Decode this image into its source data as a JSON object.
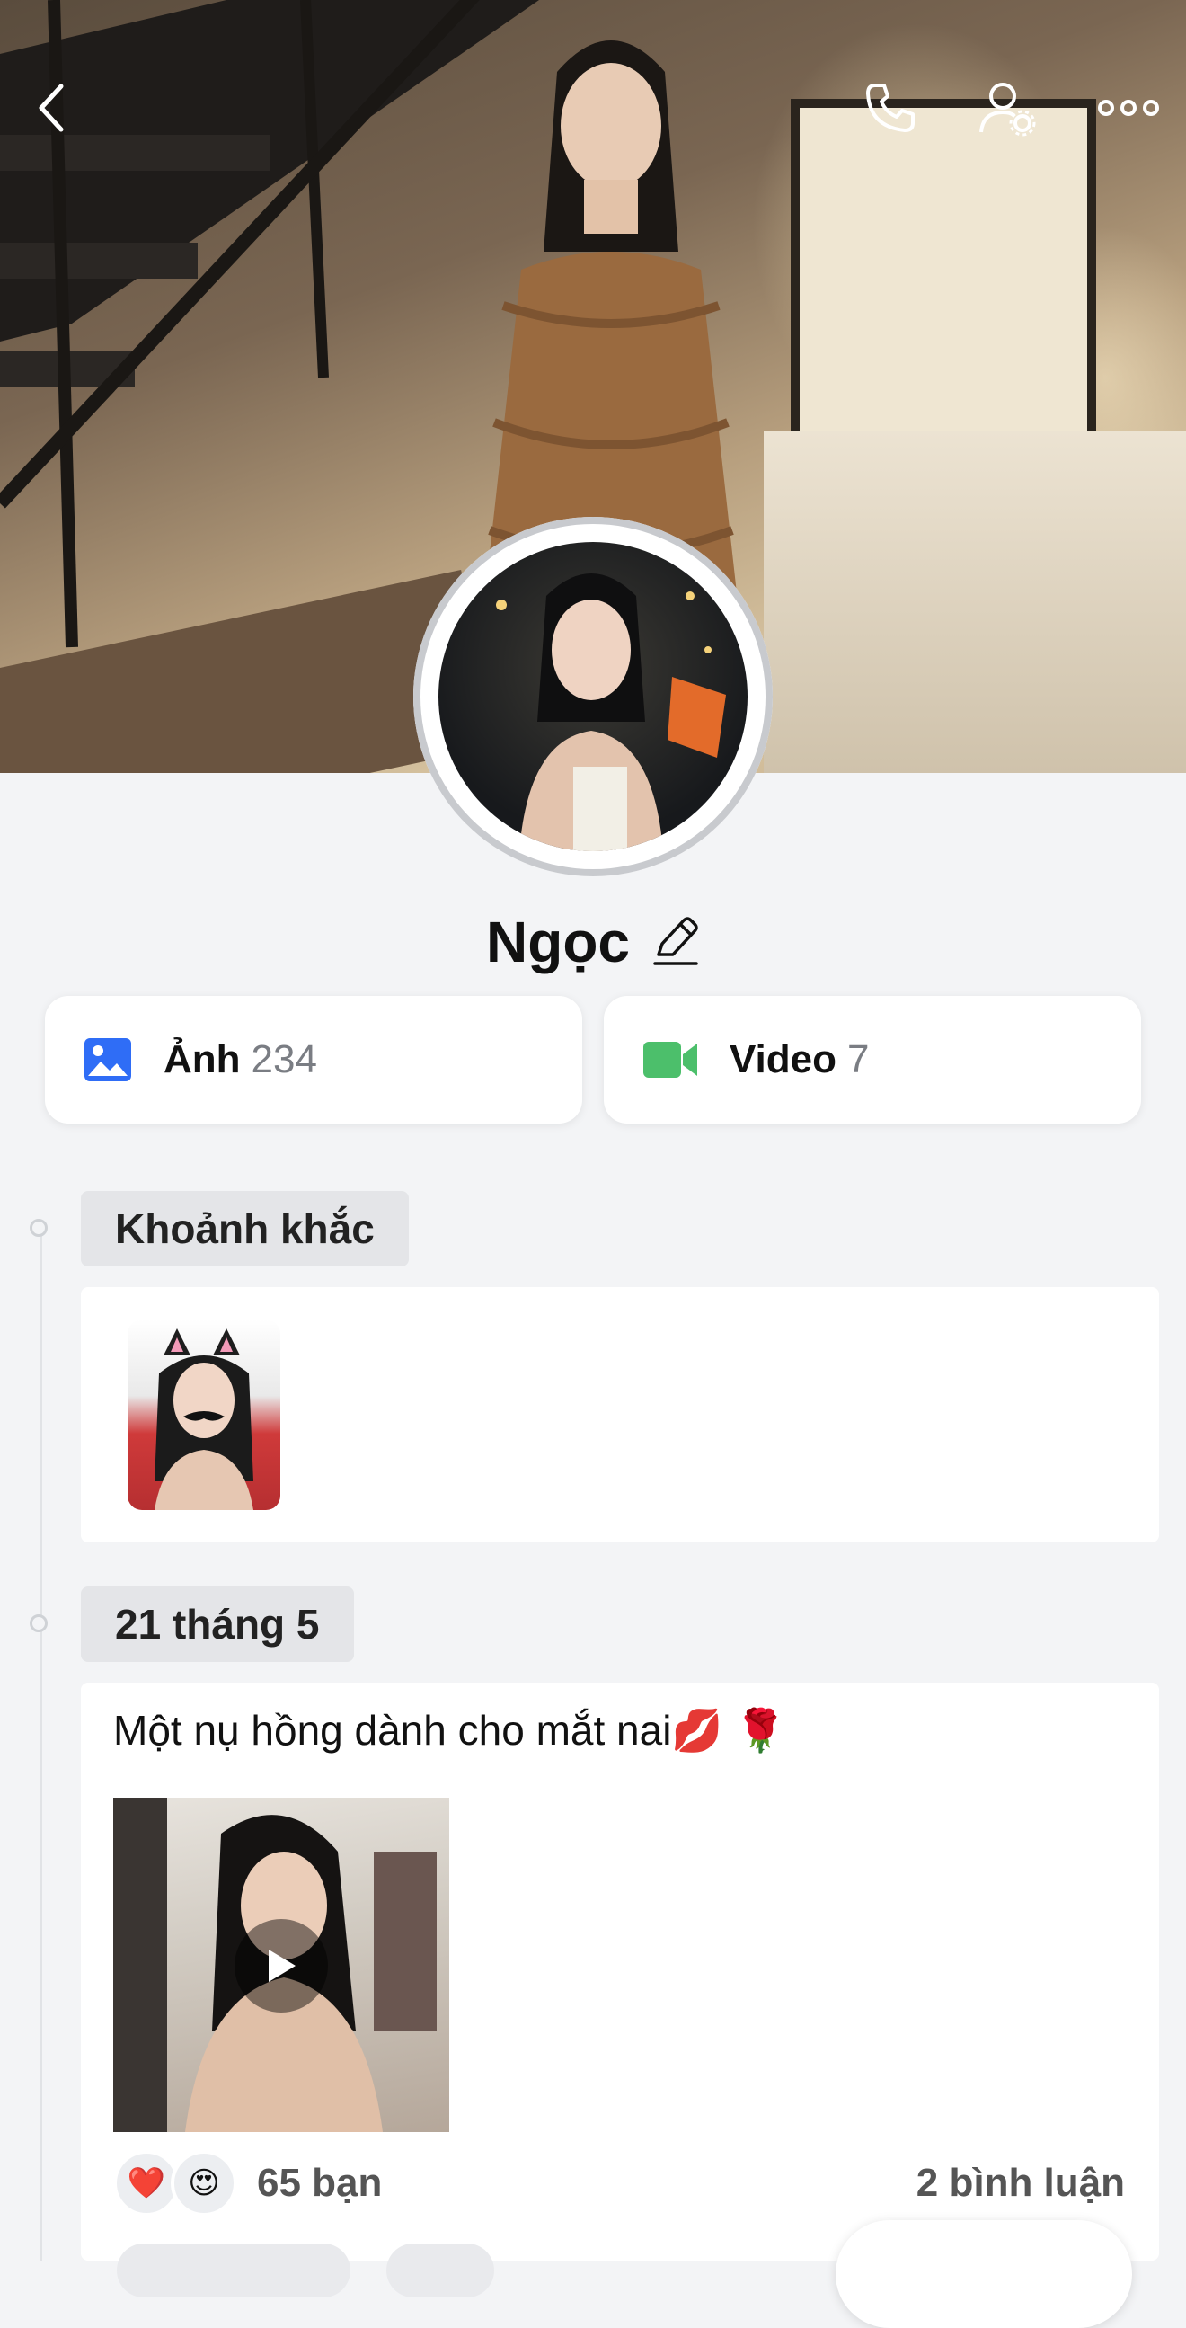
{
  "header": {
    "back_icon": "chevron-left-icon",
    "call_icon": "phone-icon",
    "settings_icon": "user-settings-icon",
    "more_icon": "more-dots-icon"
  },
  "profile": {
    "name": "Ngọc",
    "edit_icon": "pencil-icon"
  },
  "media": {
    "photos": {
      "label": "Ảnh",
      "count": "234",
      "icon": "image-icon",
      "color": "#2f6df6"
    },
    "videos": {
      "label": "Video",
      "count": "7",
      "icon": "video-camera-icon",
      "color": "#4cbf6b"
    }
  },
  "timeline": {
    "moments": {
      "title": "Khoảnh khắc"
    },
    "post": {
      "date": "21 tháng 5",
      "text": "Một nụ hồng dành cho mắt nai💋 🌹",
      "reactions": [
        "❤️",
        "😍"
      ],
      "reaction_count": "65 bạn",
      "comments": "2 bình luận"
    }
  },
  "colors": {
    "background": "#f3f4f6",
    "card": "#ffffff",
    "tag": "#e4e5e8"
  }
}
